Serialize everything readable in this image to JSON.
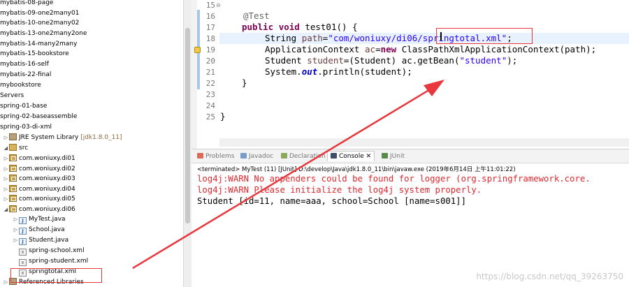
{
  "explorer": {
    "projects": [
      "mybatis-08-page",
      "mybatis-09-one2many01",
      "mybatis-10-one2many02",
      "mybatis-13-one2many2one",
      "mybatis-14-many2many",
      "mybatis-15-bookstore",
      "mybatis-16-self",
      "mybatis-22-final",
      "mybookstore",
      "Servers",
      "spring-01-base",
      "spring-02-baseassemble",
      "spring-03-di-xml"
    ],
    "jre_label": "JRE System Library",
    "jre_version": "[jdk1.8.0_11]",
    "src_label": "src",
    "packages": [
      "com.woniuxy.di01",
      "com.woniuxy.di02",
      "com.woniuxy.di03",
      "com.woniuxy.di04",
      "com.woniuxy.di05",
      "com.woniuxy.di06"
    ],
    "files": [
      {
        "name": "MyTest.java",
        "type": "java"
      },
      {
        "name": "School.java",
        "type": "java"
      },
      {
        "name": "Student.java",
        "type": "java"
      },
      {
        "name": "spring-school.xml",
        "type": "xml"
      },
      {
        "name": "spring-student.xml",
        "type": "xml"
      },
      {
        "name": "springtotal.xml",
        "type": "xml"
      }
    ],
    "ref_libs": "Referenced Libraries"
  },
  "editor": {
    "line_numbers": [
      "15",
      "16",
      "17",
      "18",
      "19",
      "20",
      "21",
      "22",
      "23",
      "24",
      "25"
    ],
    "annotation": "@Test",
    "kw_public": "public",
    "kw_void": "void",
    "method_sig": " test01() {",
    "l17_type": "String ",
    "l17_var": "path",
    "l17_eq": "=",
    "l17_str": "\"com/woniuxy/di06/springtotal.xml\"",
    "l17_end": ";",
    "l18_type": "ApplicationContext ",
    "l18_var": "ac",
    "l18_eq": "=",
    "l18_new": "new",
    "l18_rest": " ClassPathXmlApplicationContext(path);",
    "l19_type": "Student ",
    "l19_var": "student",
    "l19_rest": "=(Student) ac.getBean(",
    "l19_str": "\"student\"",
    "l19_end": ");",
    "l20_sys": "System.",
    "l20_out": "out",
    "l20_rest": ".println(student);",
    "close_method": "}",
    "close_class": "}"
  },
  "console": {
    "tabs": [
      "Problems",
      "Javadoc",
      "Declaration",
      "Console",
      "JUnit"
    ],
    "console_tab_suffix": "✕",
    "terminated": "<terminated> MyTest (11) [JUnit] D:\\develop\\Java\\jdk1.8.0_11\\bin\\javaw.exe (2019年6月14日 上午11:01:22)",
    "lines": [
      {
        "text": "log4j:WARN No appenders could be found for logger (org.springframework.core.",
        "kind": "err"
      },
      {
        "text": "log4j:WARN Please initialize the log4j system properly.",
        "kind": "err"
      },
      {
        "text": "Student [id=11, name=aaa, school=School [name=s001]]",
        "kind": "std"
      }
    ],
    "watermark": "https://blog.csdn.net/qq_39263750"
  },
  "colors": {
    "annotation_red": "#e8383d",
    "keyword": "#7f0055",
    "string": "#2a00ff",
    "error": "#e0282e"
  }
}
